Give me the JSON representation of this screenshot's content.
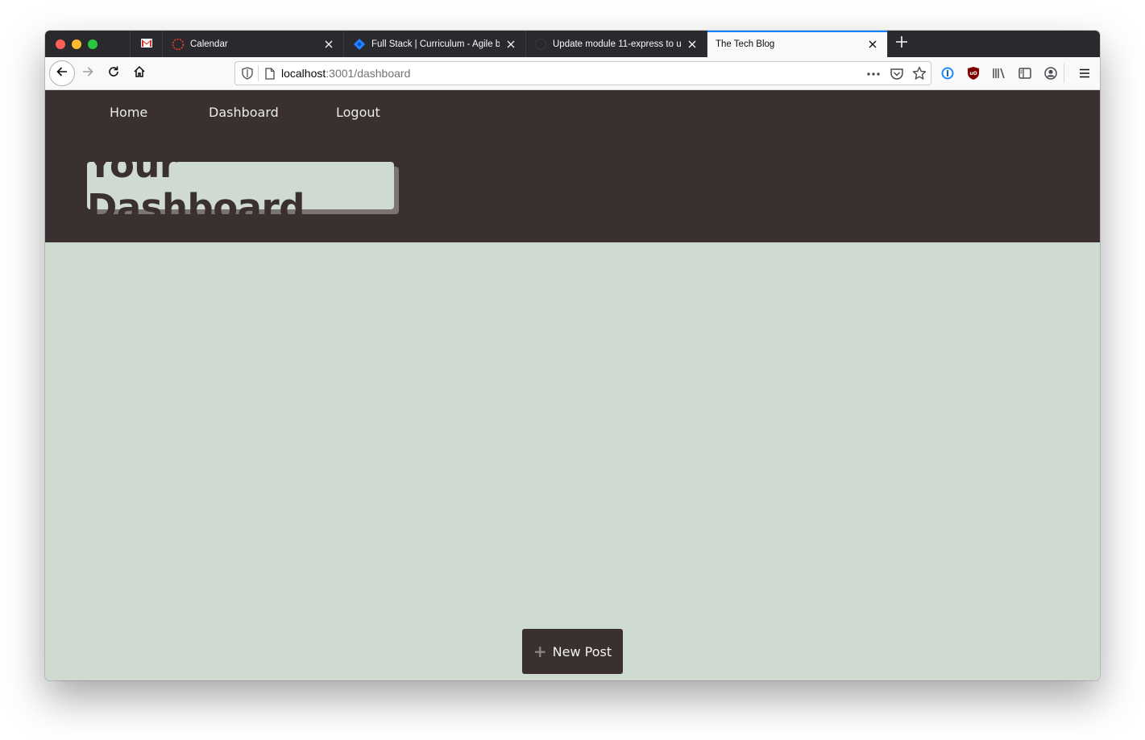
{
  "browser": {
    "tabs": [
      {
        "title": "Calendar",
        "icon": "calendar-icon"
      },
      {
        "title": "Full Stack | Curriculum - Agile b",
        "icon": "jira-icon"
      },
      {
        "title": "Update module 11-express to u",
        "icon": "github-icon"
      },
      {
        "title": "The Tech Blog",
        "icon": "none",
        "active": true
      }
    ],
    "url": {
      "host": "localhost",
      "path": ":3001/dashboard"
    }
  },
  "site": {
    "nav": {
      "home": "Home",
      "dashboard": "Dashboard",
      "logout": "Logout"
    },
    "heading": "Your Dashboard",
    "new_post_label": "New Post",
    "new_post_icon": "+"
  },
  "colors": {
    "header_bg": "#3a3030",
    "page_bg": "#cfdad1",
    "accent": "#0a84ff"
  }
}
